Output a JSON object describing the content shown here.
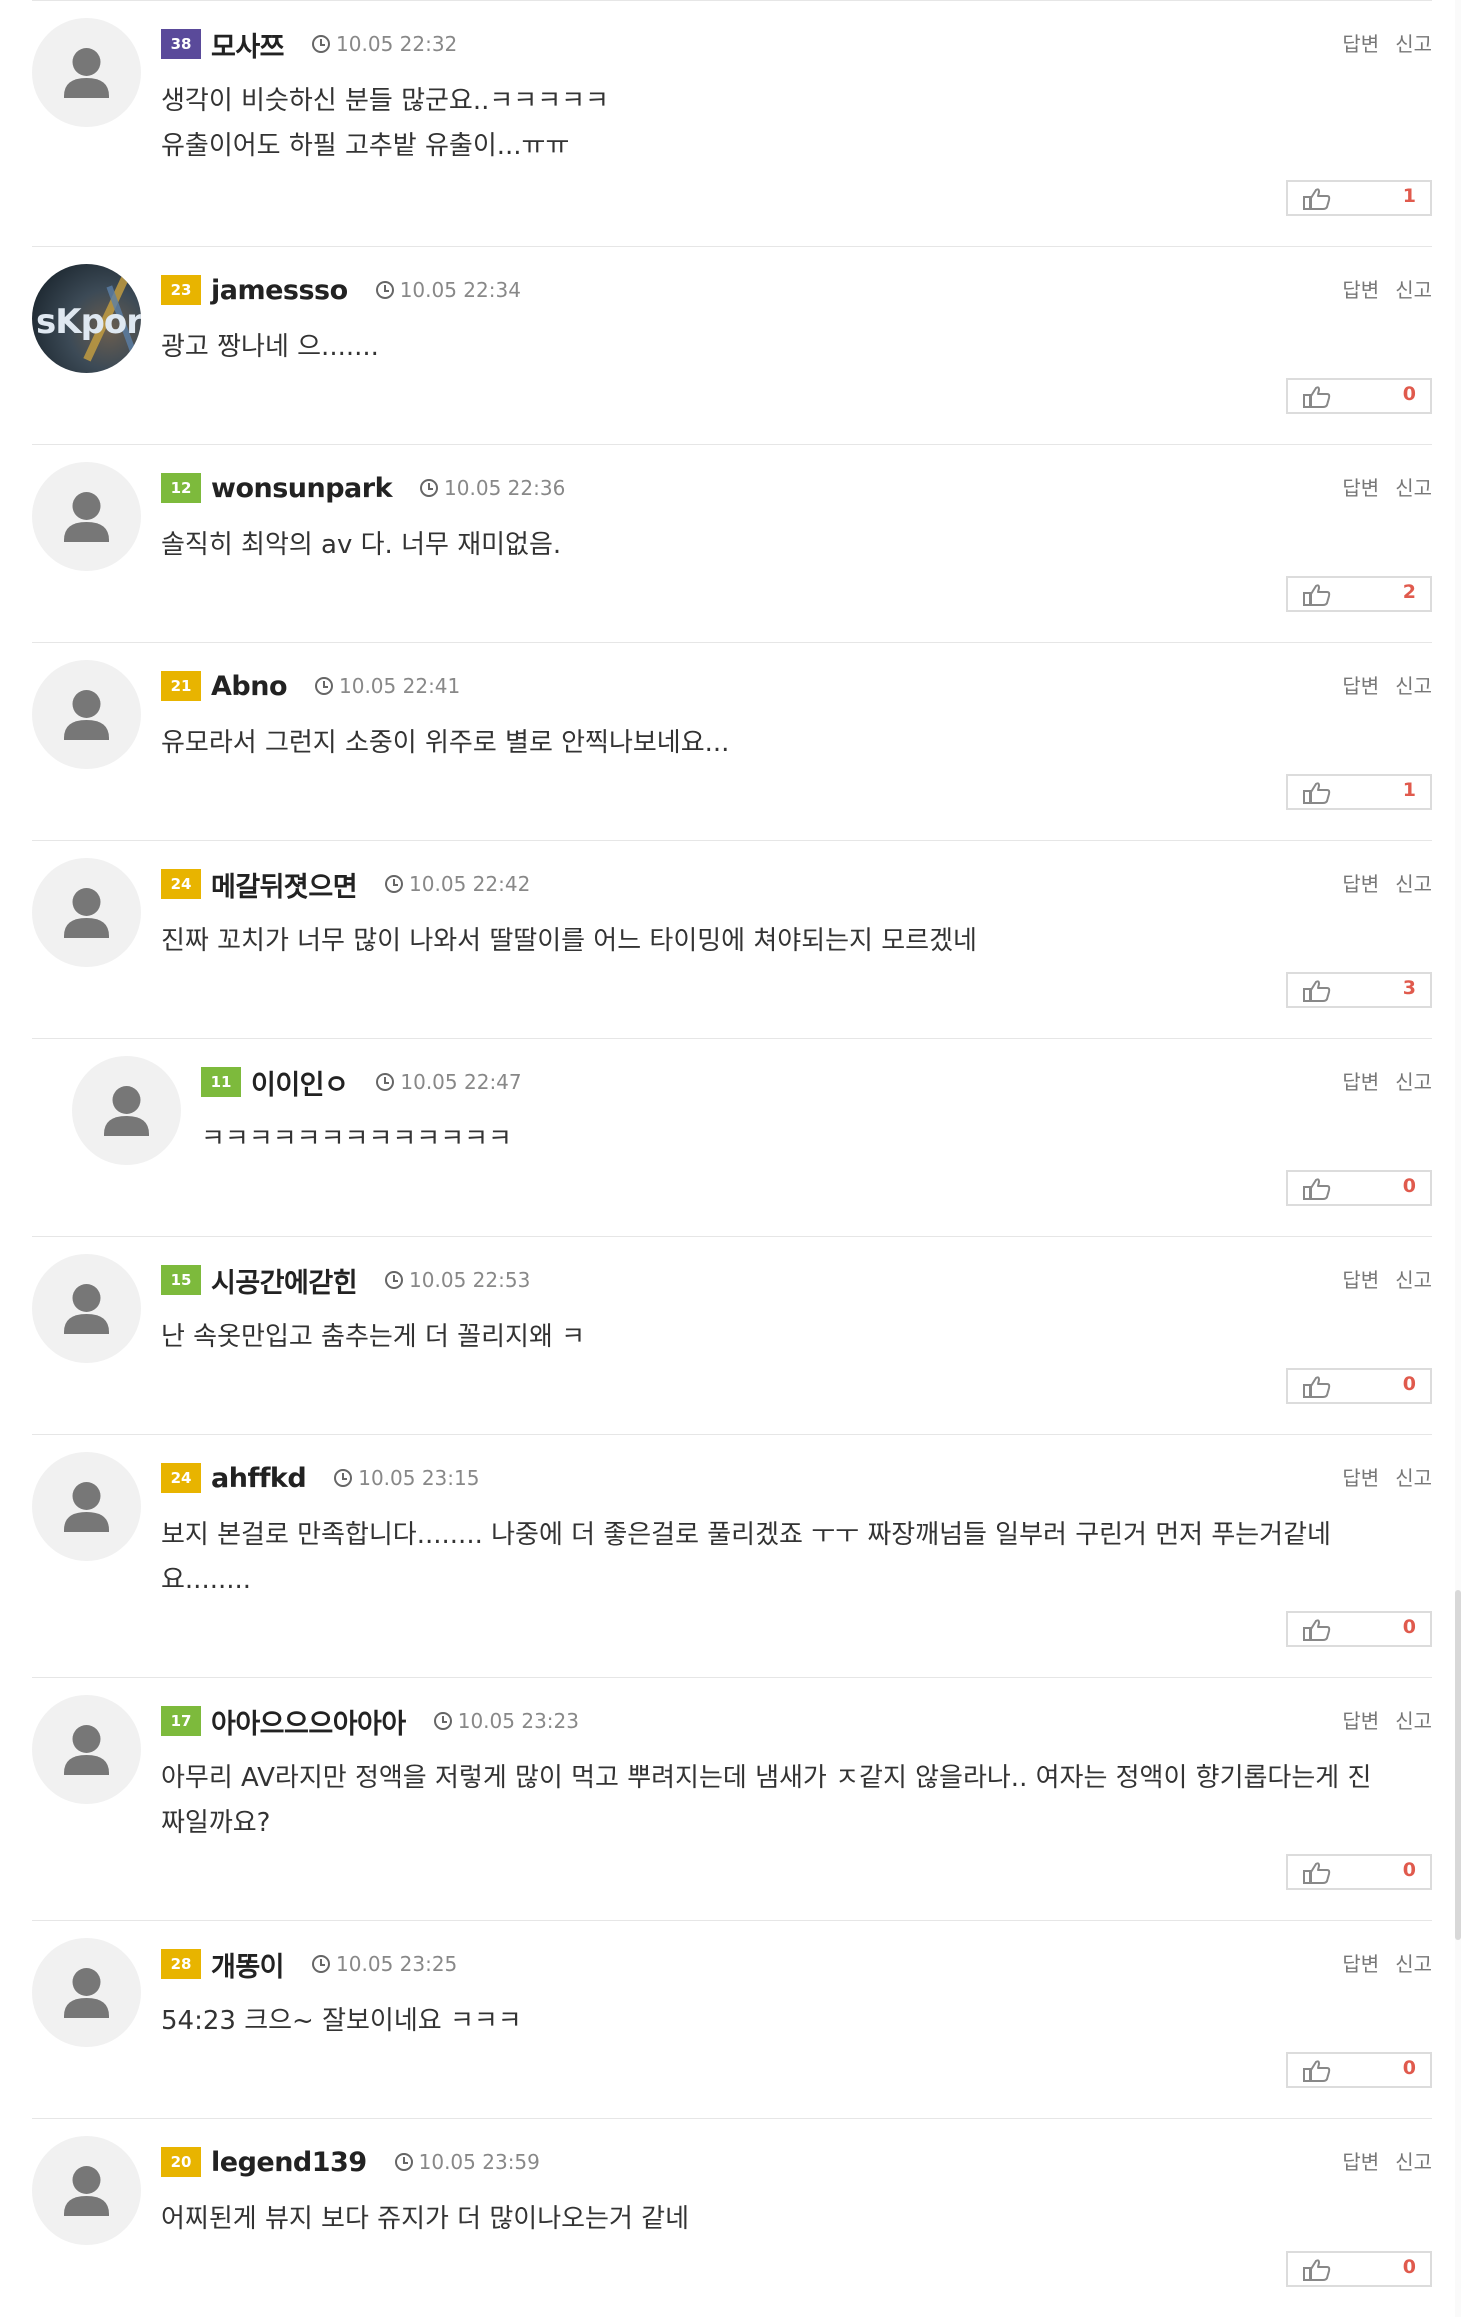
{
  "comments": [
    {
      "level": "38",
      "level_color": "#5a4a9a",
      "username": "모사쯔",
      "time": "10.05 22:32",
      "text": "생각이 비슷하신 분들 많군요..ㅋㅋㅋㅋㅋ\n유출이어도 하필 고추밭 유출이...ㅠㅠ",
      "likes": "1",
      "reply_label": "답변",
      "report_label": "신고",
      "avatar": "default-avatar-icon"
    },
    {
      "level": "23",
      "level_color": "#e8b400",
      "username": "jamessso",
      "time": "10.05 22:34",
      "text": "광고 짱나네 으.......",
      "likes": "0",
      "reply_label": "답변",
      "report_label": "신고",
      "avatar": "photo",
      "avatar_text": "sKporn"
    },
    {
      "level": "12",
      "level_color": "#7dba3c",
      "username": "wonsunpark",
      "time": "10.05 22:36",
      "text": "솔직히 최악의 av 다. 너무 재미없음.",
      "likes": "2",
      "reply_label": "답변",
      "report_label": "신고",
      "avatar": "default-avatar-icon"
    },
    {
      "level": "21",
      "level_color": "#e8b400",
      "username": "Abno",
      "time": "10.05 22:41",
      "text": "유모라서 그런지 소중이 위주로 별로 안찍나보네요...",
      "likes": "1",
      "reply_label": "답변",
      "report_label": "신고",
      "avatar": "default-avatar-icon"
    },
    {
      "level": "24",
      "level_color": "#e8b400",
      "username": "메갈뒤졋으면",
      "time": "10.05 22:42",
      "text": "진짜 꼬치가 너무 많이 나와서 딸딸이를 어느 타이밍에 쳐야되는지 모르겠네",
      "likes": "3",
      "reply_label": "답변",
      "report_label": "신고",
      "avatar": "default-avatar-icon"
    },
    {
      "level": "11",
      "level_color": "#7dba3c",
      "username": "이이인ㅇ",
      "time": "10.05 22:47",
      "text": "ㅋㅋㅋㅋㅋㅋㅋㅋㅋㅋㅋㅋㅋ",
      "likes": "0",
      "reply_label": "답변",
      "report_label": "신고",
      "avatar": "default-avatar-icon"
    },
    {
      "level": "15",
      "level_color": "#7dba3c",
      "username": "시공간에갇힌",
      "time": "10.05 22:53",
      "text": "난 속옷만입고 춤추는게 더 꼴리지왜 ㅋ",
      "likes": "0",
      "reply_label": "답변",
      "report_label": "신고",
      "avatar": "default-avatar-icon"
    },
    {
      "level": "24",
      "level_color": "#e8b400",
      "username": "ahffkd",
      "time": "10.05 23:15",
      "text": "보지 본걸로 만족합니다........ 나중에 더 좋은걸로 풀리겠죠 ㅜㅜ 짜장깨넘들 일부러 구린거 먼저 푸는거같네\n요........",
      "likes": "0",
      "reply_label": "답변",
      "report_label": "신고",
      "avatar": "default-avatar-icon"
    },
    {
      "level": "17",
      "level_color": "#7dba3c",
      "username": "아아으으으아아아",
      "time": "10.05 23:23",
      "text": "아무리 AV라지만 정액을 저렇게 많이 먹고 뿌려지는데 냄새가 ㅈ같지 않을라나.. 여자는 정액이 향기롭다는게 진\n짜일까요?",
      "likes": "0",
      "reply_label": "답변",
      "report_label": "신고",
      "avatar": "default-avatar-icon"
    },
    {
      "level": "28",
      "level_color": "#e8b400",
      "username": "개똥이",
      "time": "10.05 23:25",
      "text": "54:23 크으~ 잘보이네요 ㅋㅋㅋ",
      "likes": "0",
      "reply_label": "답변",
      "report_label": "신고",
      "avatar": "default-avatar-icon"
    },
    {
      "level": "20",
      "level_color": "#e8b400",
      "username": "legend139",
      "time": "10.05 23:59",
      "text": "어찌된게 뷰지 보다 쥬지가 더 많이나오는거 같네",
      "likes": "0",
      "reply_label": "답변",
      "report_label": "신고",
      "avatar": "default-avatar-icon"
    }
  ]
}
